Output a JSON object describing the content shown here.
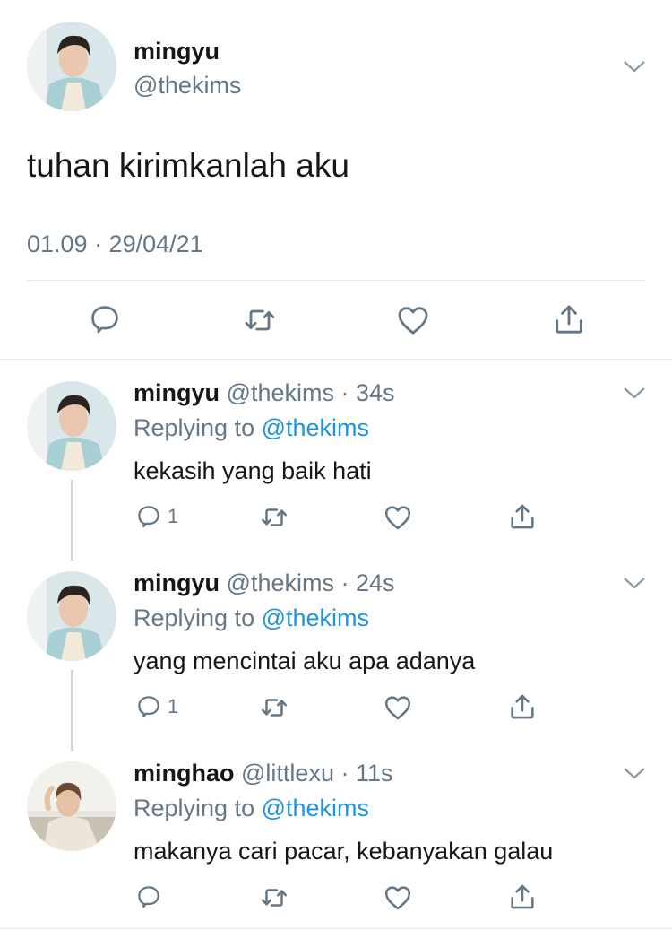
{
  "main_tweet": {
    "name": "mingyu",
    "handle": "@thekims",
    "text": "tuhan kirimkanlah aku",
    "timestamp": "01.09 · 29/04/21",
    "icons": [
      "reply-icon",
      "retweet-icon",
      "like-icon",
      "share-icon"
    ]
  },
  "replies": [
    {
      "name": "mingyu",
      "handle": "@thekims",
      "time": "34s",
      "replying_prefix": "Replying to",
      "replying_to": "@thekims",
      "text": "kekasih yang baik hati",
      "reply_count": "1"
    },
    {
      "name": "mingyu",
      "handle": "@thekims",
      "time": "24s",
      "replying_prefix": "Replying to",
      "replying_to": "@thekims",
      "text": "yang mencintai aku apa adanya",
      "reply_count": "1"
    },
    {
      "name": "minghao",
      "handle": "@littlexu",
      "time": "11s",
      "replying_prefix": "Replying to",
      "replying_to": "@thekims",
      "text": "makanya cari pacar, kebanyakan galau",
      "reply_count": ""
    }
  ],
  "colors": {
    "link": "#1b95e0",
    "muted": "#657786",
    "divider": "#e1e8ed"
  }
}
